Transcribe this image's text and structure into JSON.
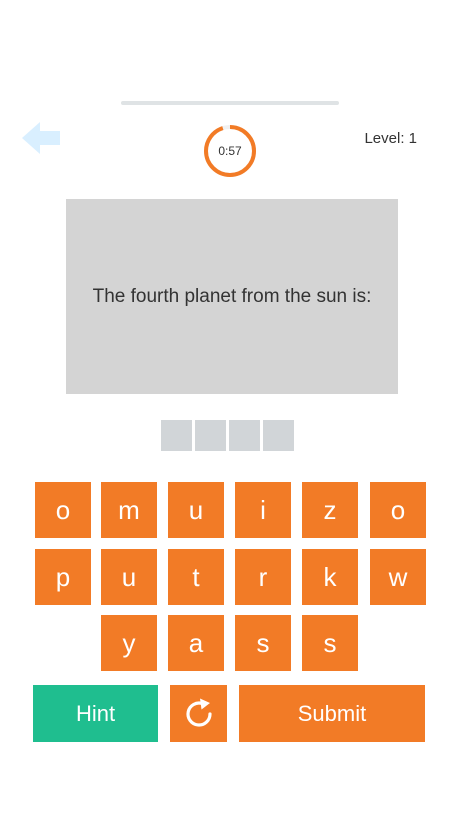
{
  "header": {
    "level_label": "Level: 1",
    "timer_text": "0:57",
    "timer_progress": 0.95,
    "progress": 0
  },
  "question": {
    "text": "The fourth planet from the sun is:"
  },
  "answer_slots_count": 4,
  "letters": {
    "row1": [
      "o",
      "m",
      "u",
      "i",
      "z",
      "o"
    ],
    "row2": [
      "p",
      "u",
      "t",
      "r",
      "k",
      "w"
    ],
    "row3": [
      "y",
      "a",
      "s",
      "s"
    ]
  },
  "actions": {
    "hint_label": "Hint",
    "submit_label": "Submit"
  },
  "colors": {
    "accent": "#f27b26",
    "hint": "#1fbe8f",
    "card": "#d4d4d4",
    "back_arrow": "#d9efff"
  }
}
